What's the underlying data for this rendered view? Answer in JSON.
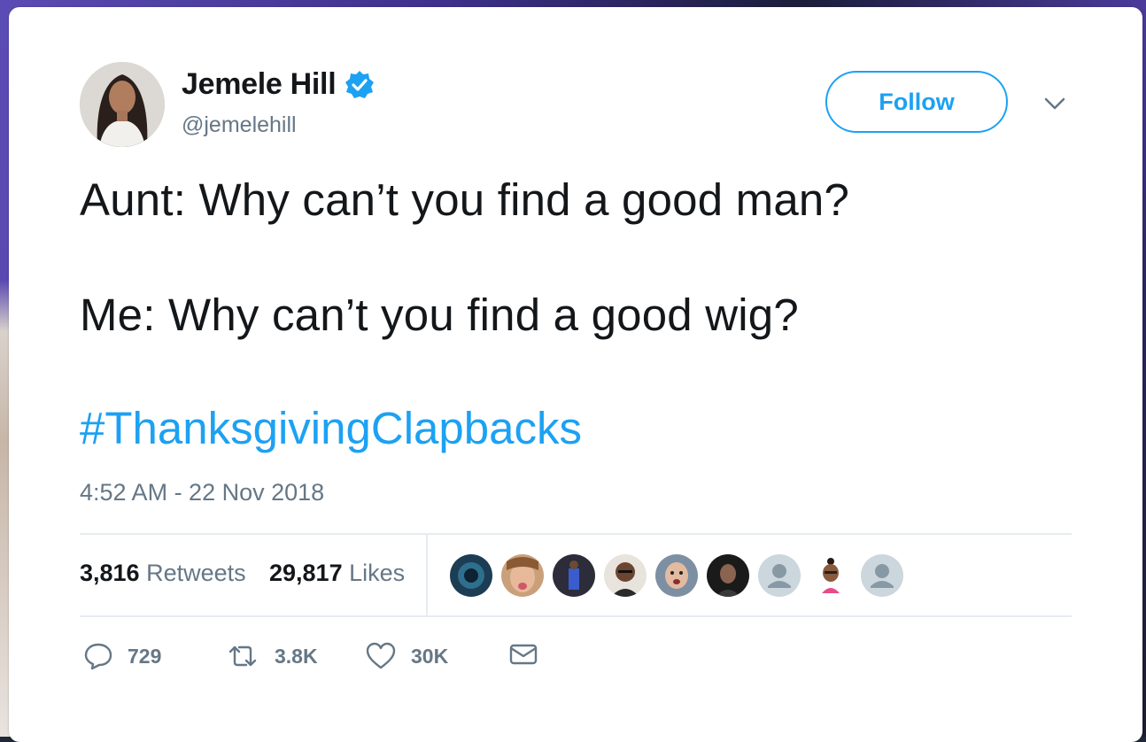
{
  "user": {
    "name": "Jemele Hill",
    "handle": "@jemelehill",
    "verified": true
  },
  "follow_button": {
    "label": "Follow"
  },
  "tweet": {
    "line1": "Aunt: Why can’t you find a good man?",
    "line2": "Me: Why can’t you find a good wig?",
    "hashtag": "#ThanksgivingClapbacks",
    "timestamp": "4:52 AM - 22 Nov 2018"
  },
  "stats": {
    "retweets_count": "3,816",
    "retweets_label": "Retweets",
    "likes_count": "29,817",
    "likes_label": "Likes"
  },
  "likers": [
    {
      "icon": "avatar-dark-blue"
    },
    {
      "icon": "avatar-face-tongue"
    },
    {
      "icon": "avatar-stage-blue"
    },
    {
      "icon": "avatar-man-glasses"
    },
    {
      "icon": "avatar-man-surprised"
    },
    {
      "icon": "avatar-woman-dark"
    },
    {
      "icon": "avatar-default-gray"
    },
    {
      "icon": "avatar-bitmoji"
    },
    {
      "icon": "avatar-default-gray"
    }
  ],
  "actions": {
    "reply_count": "729",
    "retweet_count": "3.8K",
    "like_count": "30K"
  },
  "colors": {
    "accent": "#1da1f2",
    "text": "#14171a",
    "muted": "#657786",
    "divider": "#e6ecf0"
  }
}
